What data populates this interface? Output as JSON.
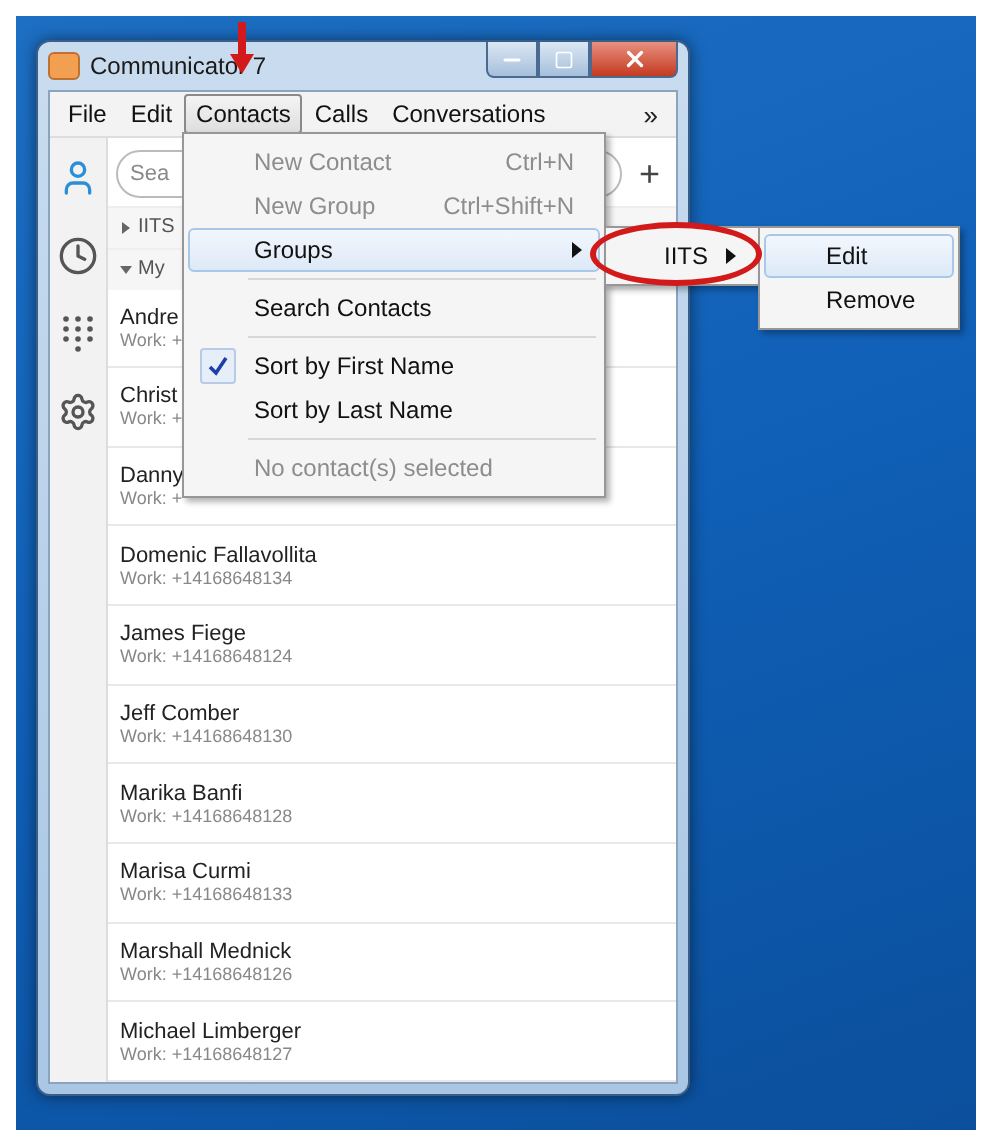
{
  "window": {
    "title": "Communicator 7"
  },
  "menu_bar": {
    "items": [
      {
        "label": "File",
        "selected": false
      },
      {
        "label": "Edit",
        "selected": false
      },
      {
        "label": "Contacts",
        "selected": true
      },
      {
        "label": "Calls",
        "selected": false
      },
      {
        "label": "Conversations",
        "selected": false
      }
    ],
    "overflow": "»"
  },
  "sidebar": {
    "items": [
      {
        "kind": "contacts",
        "selected": true
      },
      {
        "kind": "history",
        "selected": false
      },
      {
        "kind": "dialpad",
        "selected": false
      },
      {
        "kind": "settings",
        "selected": false
      }
    ]
  },
  "search": {
    "placeholder": "Sea",
    "add": "+"
  },
  "groups": [
    {
      "label": "IITS",
      "expanded": false
    },
    {
      "label": "My",
      "expanded": true
    }
  ],
  "contacts": [
    {
      "name": "Andre",
      "phone": "Work: +"
    },
    {
      "name": "Christ",
      "phone": "Work: +"
    },
    {
      "name": "Danny",
      "phone": "Work: +"
    },
    {
      "name": "Domenic Fallavollita",
      "phone": "Work: +14168648134"
    },
    {
      "name": "James Fiege",
      "phone": "Work: +14168648124"
    },
    {
      "name": "Jeff Comber",
      "phone": "Work: +14168648130"
    },
    {
      "name": "Marika Banfi",
      "phone": "Work: +14168648128"
    },
    {
      "name": "Marisa Curmi",
      "phone": "Work: +14168648133"
    },
    {
      "name": "Marshall Mednick",
      "phone": "Work: +14168648126"
    },
    {
      "name": "Michael Limberger",
      "phone": "Work: +14168648127"
    }
  ],
  "contacts_menu": {
    "items": [
      {
        "kind": "item",
        "label": "New Contact",
        "shortcut": "Ctrl+N",
        "disabled": true,
        "highlighted": false,
        "checked": false,
        "submenu": false
      },
      {
        "kind": "item",
        "label": "New Group",
        "shortcut": "Ctrl+Shift+N",
        "disabled": true,
        "highlighted": false,
        "checked": false,
        "submenu": false
      },
      {
        "kind": "item",
        "label": "Groups",
        "disabled": false,
        "highlighted": true,
        "checked": false,
        "submenu": true
      },
      {
        "kind": "separator"
      },
      {
        "kind": "item",
        "label": "Search Contacts",
        "disabled": false,
        "highlighted": false,
        "checked": false,
        "submenu": false
      },
      {
        "kind": "separator"
      },
      {
        "kind": "item",
        "label": "Sort by First Name",
        "disabled": false,
        "highlighted": false,
        "checked": true,
        "submenu": false
      },
      {
        "kind": "item",
        "label": "Sort by Last Name",
        "disabled": false,
        "highlighted": false,
        "checked": false,
        "submenu": false
      },
      {
        "kind": "separator"
      },
      {
        "kind": "item",
        "label": "No contact(s) selected",
        "disabled": true,
        "highlighted": false,
        "checked": false,
        "submenu": false
      }
    ]
  },
  "groups_submenu": {
    "items": [
      {
        "label": "IITS",
        "highlighted": false,
        "submenu": true
      }
    ]
  },
  "group_actions_submenu": {
    "items": [
      {
        "label": "Edit",
        "highlighted": true
      },
      {
        "label": "Remove",
        "highlighted": false
      }
    ]
  }
}
